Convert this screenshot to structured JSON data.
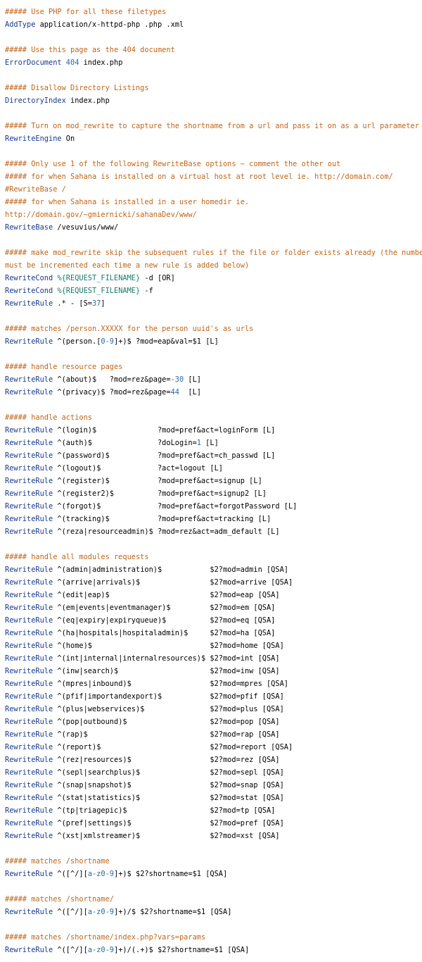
{
  "colors": {
    "comment": "#c0661a",
    "directive": "#1a3a8a",
    "number": "#2a6aa0",
    "variable": "#1a7a6a",
    "text": "#000000",
    "background": "#ffffff"
  },
  "lines": [
    [
      {
        "t": "c",
        "v": "##### Use PHP for all these filetypes"
      }
    ],
    [
      {
        "t": "k",
        "v": "AddType"
      },
      {
        "t": "s",
        "v": " application/x-httpd-php .php .xml"
      }
    ],
    [],
    [
      {
        "t": "c",
        "v": "##### Use this page as the 404 document"
      }
    ],
    [
      {
        "t": "k",
        "v": "ErrorDocument"
      },
      {
        "t": "s",
        "v": " "
      },
      {
        "t": "n",
        "v": "404"
      },
      {
        "t": "s",
        "v": " index.php"
      }
    ],
    [],
    [
      {
        "t": "c",
        "v": "##### Disallow Directory Listings"
      }
    ],
    [
      {
        "t": "k",
        "v": "DirectoryIndex"
      },
      {
        "t": "s",
        "v": " index.php"
      }
    ],
    [],
    [
      {
        "t": "c",
        "v": "##### Turn on mod_rewrite to capture the shortname from a url and pass it on as a url parameter"
      }
    ],
    [
      {
        "t": "k",
        "v": "RewriteEngine"
      },
      {
        "t": "s",
        "v": " On"
      }
    ],
    [],
    [
      {
        "t": "c",
        "v": "##### Only use 1 of the following RewriteBase options ~ comment the other out"
      }
    ],
    [
      {
        "t": "c",
        "v": "##### for when Sahana is installed on a virtual host at root level ie. http://domain.com/"
      }
    ],
    [
      {
        "t": "c",
        "v": "#RewriteBase /"
      }
    ],
    [
      {
        "t": "c",
        "v": "##### for when Sahana is installed in a user homedir ie."
      }
    ],
    [
      {
        "t": "c",
        "v": "http://domain.gov/~gmiernicki/sahanaDev/www/"
      }
    ],
    [
      {
        "t": "k",
        "v": "RewriteBase"
      },
      {
        "t": "s",
        "v": " /vesuvius/www/"
      }
    ],
    [],
    [
      {
        "t": "c",
        "v": "##### make mod_rewrite skip the subsequent rules if the file or folder exists already (the number"
      }
    ],
    [
      {
        "t": "c",
        "v": "must be incremented each time a new rule is added below)"
      }
    ],
    [
      {
        "t": "k",
        "v": "RewriteCond"
      },
      {
        "t": "s",
        "v": " "
      },
      {
        "t": "v",
        "v": "%{REQUEST_FILENAME}"
      },
      {
        "t": "s",
        "v": " -d [OR]"
      }
    ],
    [
      {
        "t": "k",
        "v": "RewriteCond"
      },
      {
        "t": "s",
        "v": " "
      },
      {
        "t": "v",
        "v": "%{REQUEST_FILENAME}"
      },
      {
        "t": "s",
        "v": " -f"
      }
    ],
    [
      {
        "t": "k",
        "v": "RewriteRule"
      },
      {
        "t": "s",
        "v": " .* - [S="
      },
      {
        "t": "n",
        "v": "37"
      },
      {
        "t": "s",
        "v": "]"
      }
    ],
    [],
    [
      {
        "t": "c",
        "v": "##### matches /person.XXXXX for the person uuid's as urls"
      }
    ],
    [
      {
        "t": "k",
        "v": "RewriteRule"
      },
      {
        "t": "s",
        "v": " ^(person.["
      },
      {
        "t": "n",
        "v": "0-9"
      },
      {
        "t": "s",
        "v": "]+)$ ?mod=eap&val=$1 [L]"
      }
    ],
    [],
    [
      {
        "t": "c",
        "v": "##### handle resource pages"
      }
    ],
    [
      {
        "t": "k",
        "v": "RewriteRule"
      },
      {
        "t": "s",
        "v": " ^(about)$   ?mod=rez&page="
      },
      {
        "t": "n",
        "v": "-30"
      },
      {
        "t": "s",
        "v": " [L]"
      }
    ],
    [
      {
        "t": "k",
        "v": "RewriteRule"
      },
      {
        "t": "s",
        "v": " ^(privacy)$ ?mod=rez&page="
      },
      {
        "t": "n",
        "v": "44"
      },
      {
        "t": "s",
        "v": "  [L]"
      }
    ],
    [],
    [
      {
        "t": "c",
        "v": "##### handle actions"
      }
    ],
    [
      {
        "t": "k",
        "v": "RewriteRule"
      },
      {
        "t": "s",
        "v": " ^(login)$              ?mod=pref&act=loginForm [L]"
      }
    ],
    [
      {
        "t": "k",
        "v": "RewriteRule"
      },
      {
        "t": "s",
        "v": " ^(auth)$               ?doLogin="
      },
      {
        "t": "n",
        "v": "1"
      },
      {
        "t": "s",
        "v": " [L]"
      }
    ],
    [
      {
        "t": "k",
        "v": "RewriteRule"
      },
      {
        "t": "s",
        "v": " ^(password)$           ?mod=pref&act=ch_passwd [L]"
      }
    ],
    [
      {
        "t": "k",
        "v": "RewriteRule"
      },
      {
        "t": "s",
        "v": " ^(logout)$             ?act=logout [L]"
      }
    ],
    [
      {
        "t": "k",
        "v": "RewriteRule"
      },
      {
        "t": "s",
        "v": " ^(register)$           ?mod=pref&act=signup [L]"
      }
    ],
    [
      {
        "t": "k",
        "v": "RewriteRule"
      },
      {
        "t": "s",
        "v": " ^(register2)$          ?mod=pref&act=signup2 [L]"
      }
    ],
    [
      {
        "t": "k",
        "v": "RewriteRule"
      },
      {
        "t": "s",
        "v": " ^(forgot)$             ?mod=pref&act=forgotPassword [L]"
      }
    ],
    [
      {
        "t": "k",
        "v": "RewriteRule"
      },
      {
        "t": "s",
        "v": " ^(tracking)$           ?mod=pref&act=tracking [L]"
      }
    ],
    [
      {
        "t": "k",
        "v": "RewriteRule"
      },
      {
        "t": "s",
        "v": " ^(reza|resourceadmin)$ ?mod=rez&act=adm_default [L]"
      }
    ],
    [],
    [
      {
        "t": "c",
        "v": "##### handle all modules requests"
      }
    ],
    [
      {
        "t": "k",
        "v": "RewriteRule"
      },
      {
        "t": "s",
        "v": " ^(admin|administration)$           $2?mod=admin [QSA]"
      }
    ],
    [
      {
        "t": "k",
        "v": "RewriteRule"
      },
      {
        "t": "s",
        "v": " ^(arrive|arrivals)$                $2?mod=arrive [QSA]"
      }
    ],
    [
      {
        "t": "k",
        "v": "RewriteRule"
      },
      {
        "t": "s",
        "v": " ^(edit|eap)$                       $2?mod=eap [QSA]"
      }
    ],
    [
      {
        "t": "k",
        "v": "RewriteRule"
      },
      {
        "t": "s",
        "v": " ^(em|events|eventmanager)$         $2?mod=em [QSA]"
      }
    ],
    [
      {
        "t": "k",
        "v": "RewriteRule"
      },
      {
        "t": "s",
        "v": " ^(eq|expiry|expiryqueue)$          $2?mod=eq [QSA]"
      }
    ],
    [
      {
        "t": "k",
        "v": "RewriteRule"
      },
      {
        "t": "s",
        "v": " ^(ha|hospitals|hospitaladmin)$     $2?mod=ha [QSA]"
      }
    ],
    [
      {
        "t": "k",
        "v": "RewriteRule"
      },
      {
        "t": "s",
        "v": " ^(home)$                           $2?mod=home [QSA]"
      }
    ],
    [
      {
        "t": "k",
        "v": "RewriteRule"
      },
      {
        "t": "s",
        "v": " ^(int|internal|internalresources)$ $2?mod=int [QSA]"
      }
    ],
    [
      {
        "t": "k",
        "v": "RewriteRule"
      },
      {
        "t": "s",
        "v": " ^(inw|search)$                     $2?mod=inw [QSA]"
      }
    ],
    [
      {
        "t": "k",
        "v": "RewriteRule"
      },
      {
        "t": "s",
        "v": " ^(mpres|inbound)$                  $2?mod=mpres [QSA]"
      }
    ],
    [
      {
        "t": "k",
        "v": "RewriteRule"
      },
      {
        "t": "s",
        "v": " ^(pfif|importandexport)$           $2?mod=pfif [QSA]"
      }
    ],
    [
      {
        "t": "k",
        "v": "RewriteRule"
      },
      {
        "t": "s",
        "v": " ^(plus|webservices)$               $2?mod=plus [QSA]"
      }
    ],
    [
      {
        "t": "k",
        "v": "RewriteRule"
      },
      {
        "t": "s",
        "v": " ^(pop|outbound)$                   $2?mod=pop [QSA]"
      }
    ],
    [
      {
        "t": "k",
        "v": "RewriteRule"
      },
      {
        "t": "s",
        "v": " ^(rap)$                            $2?mod=rap [QSA]"
      }
    ],
    [
      {
        "t": "k",
        "v": "RewriteRule"
      },
      {
        "t": "s",
        "v": " ^(report)$                         $2?mod=report [QSA]"
      }
    ],
    [
      {
        "t": "k",
        "v": "RewriteRule"
      },
      {
        "t": "s",
        "v": " ^(rez|resources)$                  $2?mod=rez [QSA]"
      }
    ],
    [
      {
        "t": "k",
        "v": "RewriteRule"
      },
      {
        "t": "s",
        "v": " ^(sepl|searchplus)$                $2?mod=sepl [QSA]"
      }
    ],
    [
      {
        "t": "k",
        "v": "RewriteRule"
      },
      {
        "t": "s",
        "v": " ^(snap|snapshot)$                  $2?mod=snap [QSA]"
      }
    ],
    [
      {
        "t": "k",
        "v": "RewriteRule"
      },
      {
        "t": "s",
        "v": " ^(stat|statistics)$                $2?mod=stat [QSA]"
      }
    ],
    [
      {
        "t": "k",
        "v": "RewriteRule"
      },
      {
        "t": "s",
        "v": " ^(tp|triagepic)$                   $2?mod=tp [QSA]"
      }
    ],
    [
      {
        "t": "k",
        "v": "RewriteRule"
      },
      {
        "t": "s",
        "v": " ^(pref|settings)$                  $2?mod=pref [QSA]"
      }
    ],
    [
      {
        "t": "k",
        "v": "RewriteRule"
      },
      {
        "t": "s",
        "v": " ^(xst|xmlstreamer)$                $2?mod=xst [QSA]"
      }
    ],
    [],
    [
      {
        "t": "c",
        "v": "##### matches /shortname"
      }
    ],
    [
      {
        "t": "k",
        "v": "RewriteRule"
      },
      {
        "t": "s",
        "v": " ^([^/]["
      },
      {
        "t": "n",
        "v": "a-z0-9"
      },
      {
        "t": "s",
        "v": "]+)$ $2?shortname=$1 [QSA]"
      }
    ],
    [],
    [
      {
        "t": "c",
        "v": "##### matches /shortname/"
      }
    ],
    [
      {
        "t": "k",
        "v": "RewriteRule"
      },
      {
        "t": "s",
        "v": " ^([^/]["
      },
      {
        "t": "n",
        "v": "a-z0-9"
      },
      {
        "t": "s",
        "v": "]+)/$ $2?shortname=$1 [QSA]"
      }
    ],
    [],
    [
      {
        "t": "c",
        "v": "##### matches /shortname/index.php?vars=params"
      }
    ],
    [
      {
        "t": "k",
        "v": "RewriteRule"
      },
      {
        "t": "s",
        "v": " ^([^/]["
      },
      {
        "t": "n",
        "v": "a-z0-9"
      },
      {
        "t": "s",
        "v": "]+)/(.+)$ $2?shortname=$1 [QSA]"
      }
    ]
  ]
}
